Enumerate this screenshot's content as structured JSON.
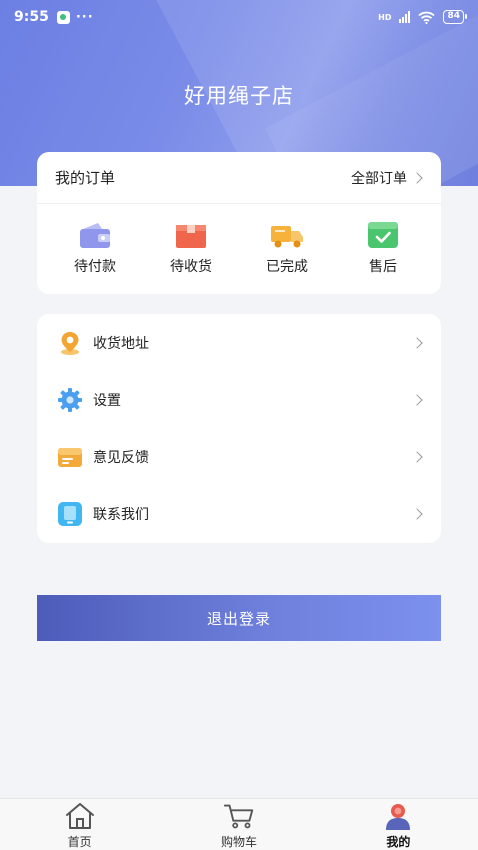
{
  "status_bar": {
    "time": "9:55",
    "dots": "···",
    "network": "HD",
    "battery": "84"
  },
  "header": {
    "title": "好用绳子店"
  },
  "orders": {
    "title": "我的订单",
    "view_all": "全部订单",
    "statuses": [
      {
        "label": "待付款",
        "icon": "wallet-icon"
      },
      {
        "label": "待收货",
        "icon": "package-icon"
      },
      {
        "label": "已完成",
        "icon": "delivery-truck-icon"
      },
      {
        "label": "售后",
        "icon": "checkmark-box-icon"
      }
    ]
  },
  "menu": {
    "items": [
      {
        "label": "收货地址",
        "icon": "location-pin-icon"
      },
      {
        "label": "设置",
        "icon": "gear-icon"
      },
      {
        "label": "意见反馈",
        "icon": "feedback-folder-icon"
      },
      {
        "label": "联系我们",
        "icon": "phone-icon"
      }
    ]
  },
  "logout": {
    "label": "退出登录"
  },
  "tabbar": {
    "tabs": [
      {
        "label": "首页",
        "icon": "home-icon"
      },
      {
        "label": "购物车",
        "icon": "cart-icon"
      },
      {
        "label": "我的",
        "icon": "profile-icon"
      }
    ],
    "active_index": 2
  },
  "colors": {
    "header_gradient_start": "#6c7fe3",
    "header_gradient_end": "#8d9cec",
    "logout_gradient_start": "#4d5bb9",
    "logout_gradient_end": "#7c90ee",
    "background": "#f3f4f7"
  }
}
